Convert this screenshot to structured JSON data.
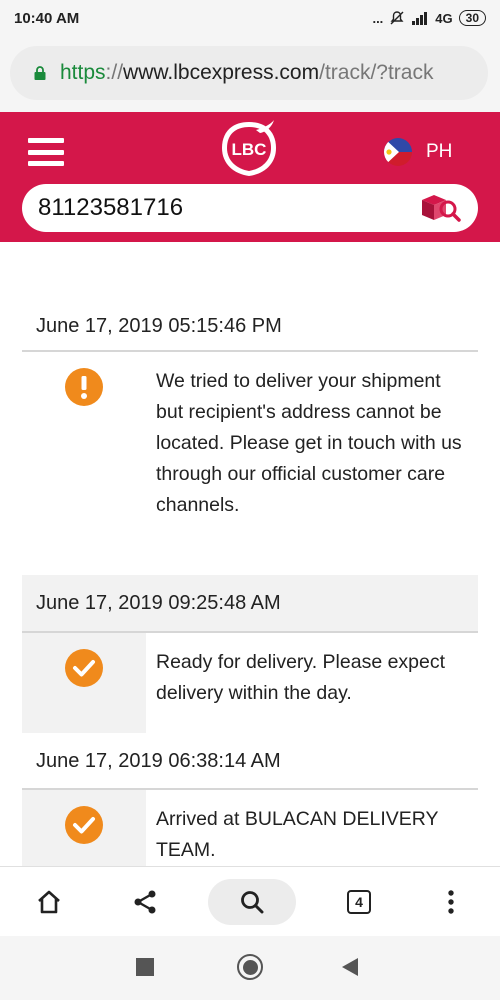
{
  "status_bar": {
    "time": "10:40 AM",
    "signal_text": "...",
    "network": "4G",
    "battery": "30"
  },
  "browser": {
    "url_scheme": "https",
    "url_sep": "://",
    "url_host": "www.lbcexpress.com",
    "url_path": "/track/?track"
  },
  "header": {
    "logo_text": "LBC",
    "country_code": "PH",
    "tracking_number": "81123581716"
  },
  "tracking": {
    "entries": [
      {
        "date": "June 17, 2019 05:15:46 PM",
        "status": "warning",
        "message": "We tried to deliver your shipment but recipient's address cannot be located. Please get in touch with us through our official customer care channels."
      },
      {
        "date": "June 17, 2019 09:25:48 AM",
        "status": "done",
        "message": "Ready for delivery. Please expect delivery within the day."
      },
      {
        "date": "June 17, 2019 06:38:14 AM",
        "status": "done",
        "message": "Arrived at BULACAN DELIVERY TEAM."
      }
    ]
  },
  "bottom_nav": {
    "tab_count": "4"
  },
  "colors": {
    "brand": "#d4174a",
    "status_icon": "#f08a1c",
    "url_secure": "#1a8a3b"
  }
}
